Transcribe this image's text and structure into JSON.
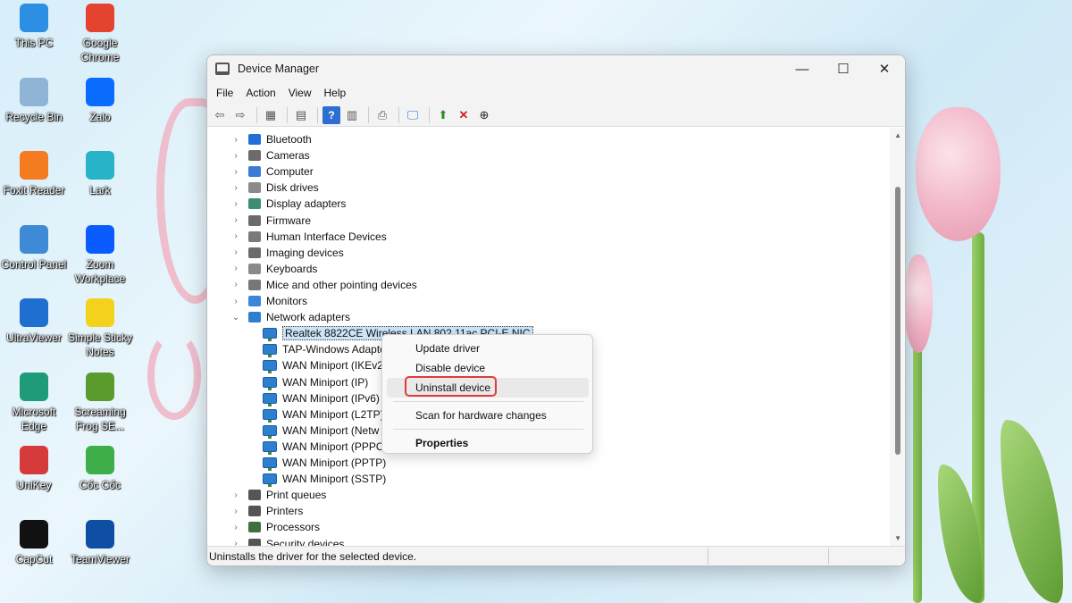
{
  "desktop": {
    "icons": [
      {
        "label": "This PC",
        "icon": "monitor-icon",
        "color": "#2d8fe3"
      },
      {
        "label": "Google Chrome",
        "icon": "chrome-icon",
        "color": "#e4432f"
      },
      {
        "label": "Recycle Bin",
        "icon": "recycle-bin-icon",
        "color": "#8fb4d6"
      },
      {
        "label": "Zalo",
        "icon": "zalo-icon",
        "color": "#0a6cff"
      },
      {
        "label": "Foxit Reader",
        "icon": "foxit-icon",
        "color": "#f47b20"
      },
      {
        "label": "Lark",
        "icon": "lark-icon",
        "color": "#27b4c8"
      },
      {
        "label": "Control Panel",
        "icon": "control-panel-icon",
        "color": "#3f8ad6"
      },
      {
        "label": "Zoom Workplace",
        "icon": "zoom-icon",
        "color": "#0b5cff"
      },
      {
        "label": "UltraViewer",
        "icon": "ultraviewer-icon",
        "color": "#1e6fd0"
      },
      {
        "label": "Simple Sticky Notes",
        "icon": "sticky-notes-icon",
        "color": "#f3d21c"
      },
      {
        "label": "Microsoft Edge",
        "icon": "edge-icon",
        "color": "#1f9b7a"
      },
      {
        "label": "Screaming Frog SE...",
        "icon": "frog-icon",
        "color": "#5b9b2e"
      },
      {
        "label": "UniKey",
        "icon": "unikey-icon",
        "color": "#d63b3b"
      },
      {
        "label": "Cốc Cốc",
        "icon": "coccoc-icon",
        "color": "#3dae4a"
      },
      {
        "label": "CapCut",
        "icon": "capcut-icon",
        "color": "#111111"
      },
      {
        "label": "TeamViewer",
        "icon": "teamviewer-icon",
        "color": "#0e4fa3"
      }
    ]
  },
  "window": {
    "title": "Device Manager",
    "minimize": "—",
    "maximize": "☐",
    "close": "✕"
  },
  "menu": [
    "File",
    "Action",
    "View",
    "Help"
  ],
  "toolbar": {
    "back": "⇦",
    "forward": "⇨",
    "show_hide": "▦",
    "properties": "▤",
    "help": "?",
    "view": "▥",
    "update": "⎙",
    "scan": "🖵",
    "enable": "⬆",
    "uninstall": "✕",
    "rollback": "⊕"
  },
  "tree": {
    "categories_top": [
      {
        "label": "Bluetooth",
        "color": "#1f6fd6"
      },
      {
        "label": "Cameras",
        "color": "#6b6b6b"
      },
      {
        "label": "Computer",
        "color": "#3a7bd5"
      },
      {
        "label": "Disk drives",
        "color": "#8a8a8a"
      },
      {
        "label": "Display adapters",
        "color": "#3b8f6e"
      },
      {
        "label": "Firmware",
        "color": "#6b6b6b"
      },
      {
        "label": "Human Interface Devices",
        "color": "#7a7a7a"
      },
      {
        "label": "Imaging devices",
        "color": "#6b6b6b"
      },
      {
        "label": "Keyboards",
        "color": "#8a8a8a"
      },
      {
        "label": "Mice and other pointing devices",
        "color": "#777777"
      },
      {
        "label": "Monitors",
        "color": "#3a86d8"
      }
    ],
    "network_adapters": {
      "label": "Network adapters",
      "children": [
        "Realtek 8822CE Wireless LAN 802.11ac PCI-E NIC",
        "TAP-Windows Adapter",
        "WAN Miniport (IKEv2",
        "WAN Miniport (IP)",
        "WAN Miniport (IPv6)",
        "WAN Miniport (L2TP)",
        "WAN Miniport (Netw",
        "WAN Miniport (PPPOE",
        "WAN Miniport (PPTP)",
        "WAN Miniport (SSTP)"
      ]
    },
    "categories_bottom": [
      {
        "label": "Print queues",
        "color": "#555555"
      },
      {
        "label": "Printers",
        "color": "#555555"
      },
      {
        "label": "Processors",
        "color": "#3f6f3f"
      },
      {
        "label": "Security devices",
        "color": "#555555"
      }
    ]
  },
  "context_menu": {
    "update_driver": "Update driver",
    "disable_device": "Disable device",
    "uninstall_device": "Uninstall device",
    "scan_hardware": "Scan for hardware changes",
    "properties": "Properties"
  },
  "status_bar": {
    "text": "Uninstalls the driver for the selected device."
  }
}
